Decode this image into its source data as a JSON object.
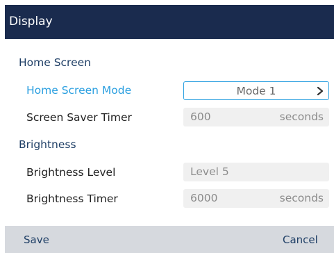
{
  "window": {
    "title": "Display"
  },
  "sections": [
    {
      "heading": "Home Screen",
      "rows": [
        {
          "label": "Home Screen Mode",
          "value": "Mode 1",
          "unit": ""
        },
        {
          "label": "Screen Saver Timer",
          "value": "600",
          "unit": "seconds"
        }
      ]
    },
    {
      "heading": "Brightness",
      "rows": [
        {
          "label": "Brightness Level",
          "value": "Level 5",
          "unit": ""
        },
        {
          "label": "Brightness Timer",
          "value": "6000",
          "unit": "seconds"
        }
      ]
    }
  ],
  "softkeys": {
    "save": "Save",
    "cancel": "Cancel"
  },
  "icons": {
    "selector": "chevron-right-icon"
  },
  "colors": {
    "title_bar": "#1a2b4e",
    "accent": "#2a9fe0",
    "heading": "#1f3f66",
    "field_bg": "#f0f0f0",
    "bottom_bar": "#d6d9de"
  }
}
